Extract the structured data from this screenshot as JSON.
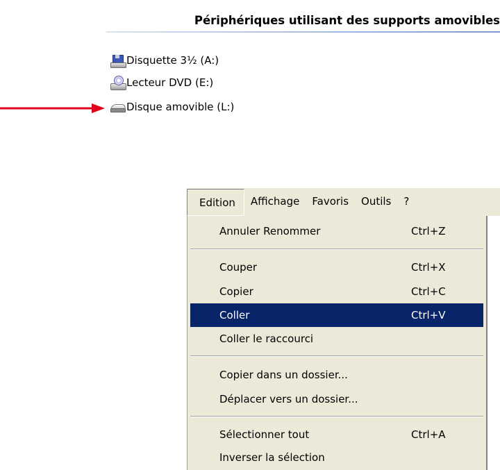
{
  "devices": {
    "header": "Périphériques utilisant des supports amovibles",
    "items": [
      {
        "label": "Disquette 3½ (A:)",
        "icon": "floppy-drive-icon"
      },
      {
        "label": "Lecteur DVD (E:)",
        "icon": "dvd-drive-icon"
      },
      {
        "label": "Disque amovible (L:)",
        "icon": "removable-drive-icon"
      }
    ]
  },
  "arrow_color": "#e0001b",
  "menubar": {
    "items": [
      "Edition",
      "Affichage",
      "Favoris",
      "Outils",
      "?"
    ],
    "active": "Edition"
  },
  "menu": {
    "items": [
      {
        "label": "Annuler Renommer",
        "shortcut": "Ctrl+Z"
      },
      {
        "label": "Couper",
        "shortcut": "Ctrl+X"
      },
      {
        "label": "Copier",
        "shortcut": "Ctrl+C"
      },
      {
        "label": "Coller",
        "shortcut": "Ctrl+V",
        "highlighted": true
      },
      {
        "label": "Coller le raccourci",
        "shortcut": ""
      },
      {
        "label": "Copier dans un dossier...",
        "shortcut": ""
      },
      {
        "label": "Déplacer vers un dossier...",
        "shortcut": ""
      },
      {
        "label": "Sélectionner tout",
        "shortcut": "Ctrl+A"
      },
      {
        "label": "Inverser la sélection",
        "shortcut": ""
      }
    ],
    "highlight_color": "#0a246a",
    "background_color": "#ece9d8"
  }
}
